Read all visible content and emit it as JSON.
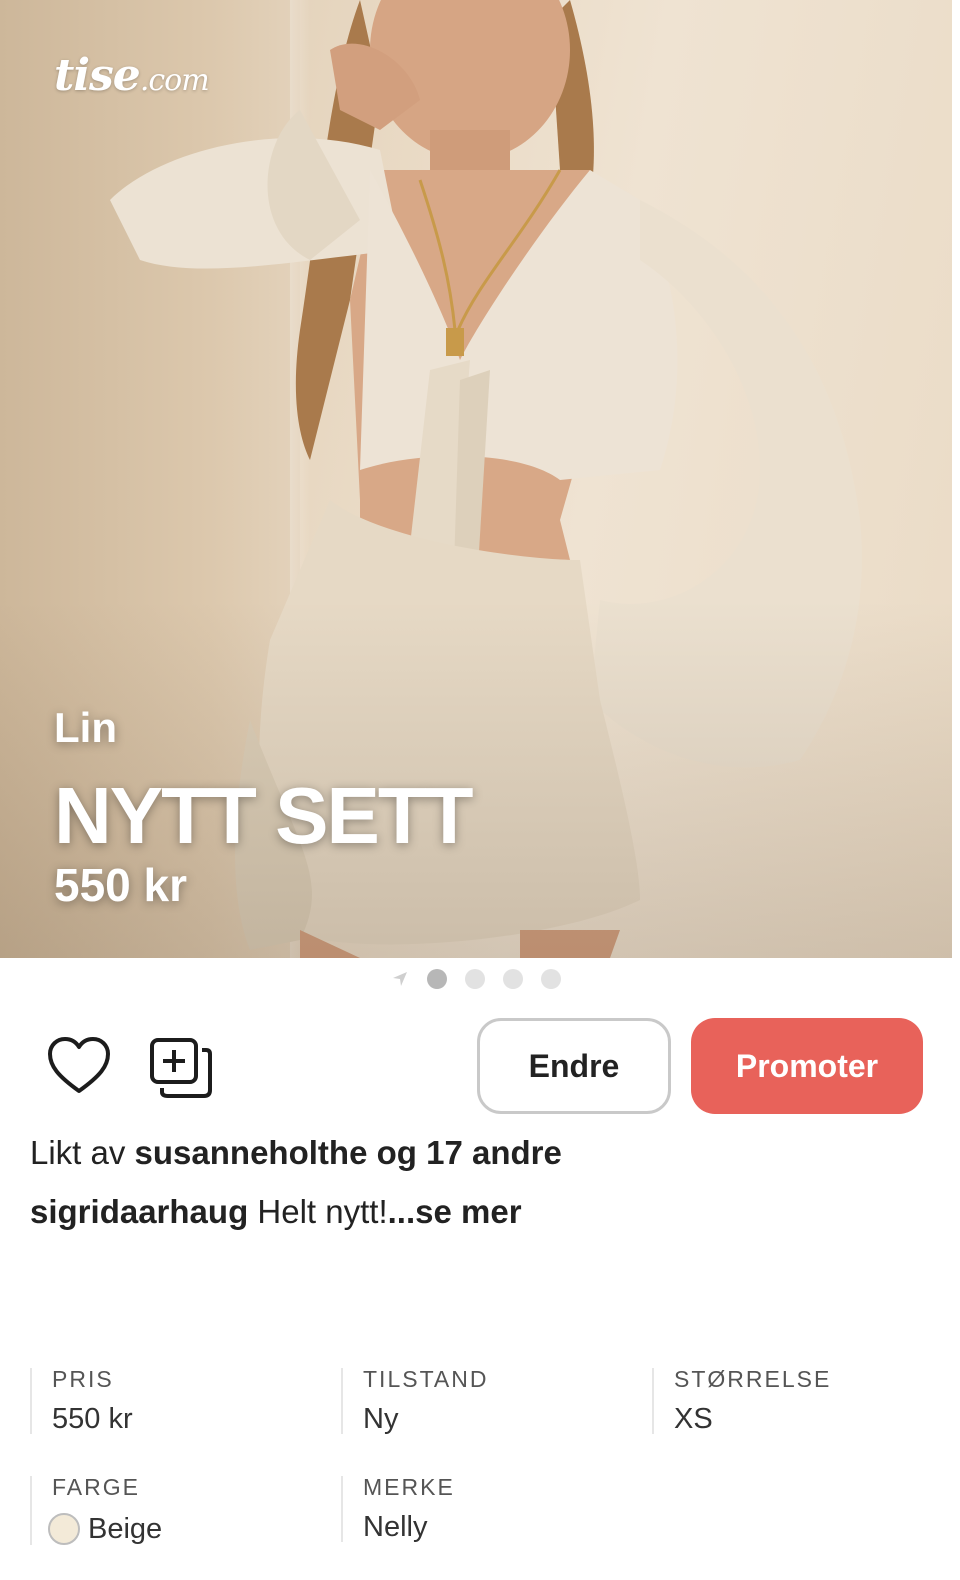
{
  "hero": {
    "logo_main": "tise",
    "logo_suffix": ".com",
    "subtitle": "Lin",
    "title": "NYTT SETT",
    "price": "550 kr"
  },
  "pager": {
    "total": 4,
    "active_index": 0
  },
  "actions": {
    "edit_label": "Endre",
    "promote_label": "Promoter"
  },
  "social": {
    "likes_prefix": "Likt av",
    "liked_by_user": "susanneholthe",
    "likes_and": "og",
    "likes_others": "17 andre",
    "seller": "sigridaarhaug",
    "description": "Helt nytt!",
    "see_more": "...se mer"
  },
  "details": {
    "price": {
      "label": "PRIS",
      "value": "550 kr"
    },
    "condition": {
      "label": "TILSTAND",
      "value": "Ny"
    },
    "size": {
      "label": "STØRRELSE",
      "value": "XS"
    },
    "color": {
      "label": "FARGE",
      "value": "Beige",
      "swatch": "#f3ead8"
    },
    "brand": {
      "label": "MERKE",
      "value": "Nelly"
    }
  },
  "colors": {
    "accent": "#e8625a",
    "border": "#c9c9c9"
  }
}
